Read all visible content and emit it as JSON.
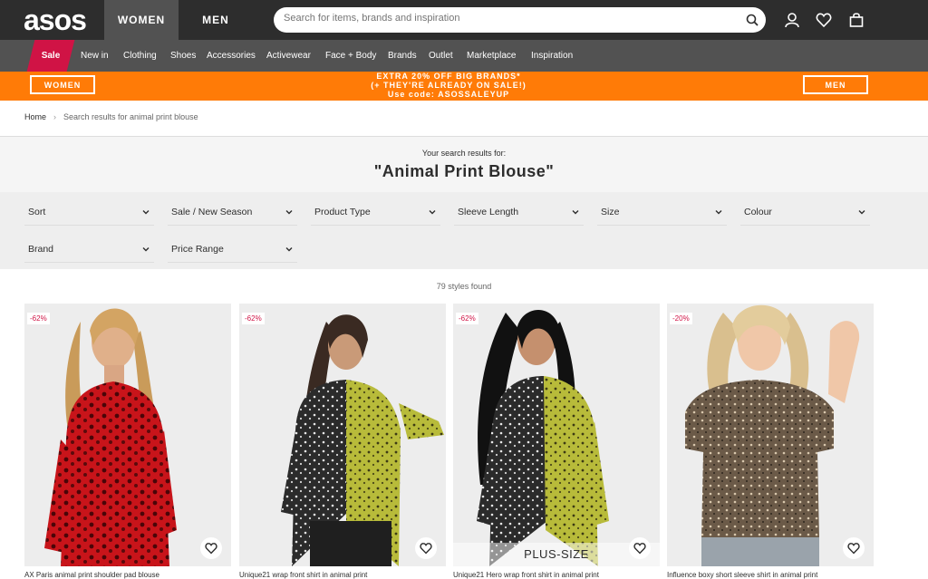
{
  "header": {
    "logo": "asos",
    "gender_tabs": [
      "WOMEN",
      "MEN"
    ],
    "search_placeholder": "Search for items, brands and inspiration",
    "icons": [
      "search-icon",
      "account-icon",
      "heart-icon",
      "bag-icon"
    ]
  },
  "nav": {
    "sale": "Sale",
    "items": [
      "New in",
      "Clothing",
      "Shoes",
      "Accessories",
      "Activewear",
      "Face + Body",
      "Brands",
      "Outlet",
      "Marketplace",
      "Inspiration"
    ]
  },
  "promo": {
    "left_button": "WOMEN",
    "right_button": "MEN",
    "line1": "EXTRA 20% OFF BIG BRANDS*",
    "line2": "(+ THEY'RE ALREADY ON SALE!)",
    "line3": "Use code: ASOSSALEYUP",
    "color": "#ff7b07"
  },
  "breadcrumb": {
    "home": "Home",
    "separator": "›",
    "current": "Search results for animal print blouse"
  },
  "results": {
    "intro": "Your search results for:",
    "term": "\"Animal Print Blouse\"",
    "count": "79 styles found"
  },
  "filters": [
    "Sort",
    "Sale / New Season",
    "Product Type",
    "Sleeve Length",
    "Size",
    "Colour",
    "Brand",
    "Price Range"
  ],
  "products": [
    {
      "badge": "-62%",
      "title": "AX Paris animal print shoulder pad blouse"
    },
    {
      "badge": "-62%",
      "title": "Unique21 wrap front shirt in animal print"
    },
    {
      "badge": "-62%",
      "title": "Unique21 Hero wrap front shirt in animal print",
      "tag": "PLUS-SIZE"
    },
    {
      "badge": "-20%",
      "title": "Influence boxy short sleeve shirt in animal print"
    }
  ],
  "colors": {
    "brand_dark": "#2d2d2d",
    "nav_grey": "#525252",
    "sale_red": "#d01345"
  }
}
